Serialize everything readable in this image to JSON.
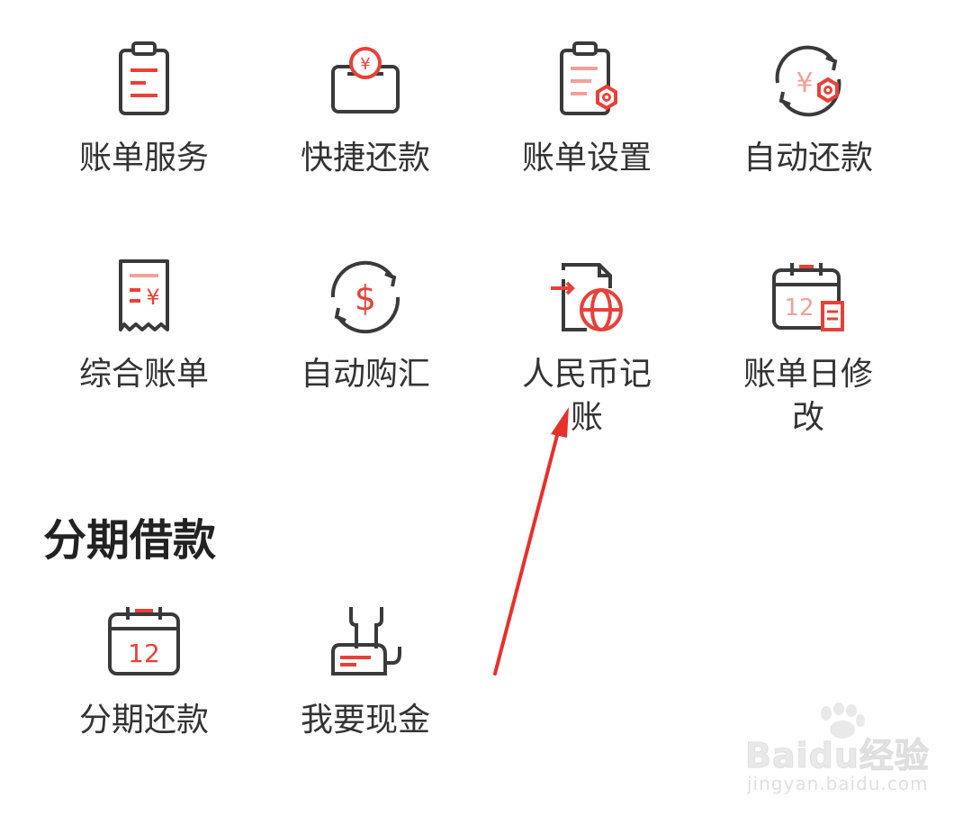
{
  "grid_items": [
    {
      "label": "账单服务",
      "icon": "bill-service-icon"
    },
    {
      "label": "快捷还款",
      "icon": "quick-repay-icon"
    },
    {
      "label": "账单设置",
      "icon": "bill-settings-icon"
    },
    {
      "label": "自动还款",
      "icon": "auto-repay-icon"
    },
    {
      "label": "综合账单",
      "icon": "combined-bill-icon"
    },
    {
      "label": "自动购汇",
      "icon": "auto-exchange-icon"
    },
    {
      "label": "人民币记账",
      "icon": "rmb-accounting-icon"
    },
    {
      "label": "账单日修改",
      "icon": "bill-date-change-icon"
    }
  ],
  "installment_section": {
    "title": "分期借款",
    "items": [
      {
        "label": "分期还款",
        "icon": "installment-repay-icon"
      },
      {
        "label": "我要现金",
        "icon": "cash-loan-icon"
      }
    ]
  },
  "watermark": {
    "brand": "Baidu经验",
    "site": "jingyan.baidu.com"
  },
  "colors": {
    "accent": "#e8413a",
    "accent_light": "#f2a09a",
    "icon_dark": "#3a3a3a",
    "text": "#333333"
  }
}
